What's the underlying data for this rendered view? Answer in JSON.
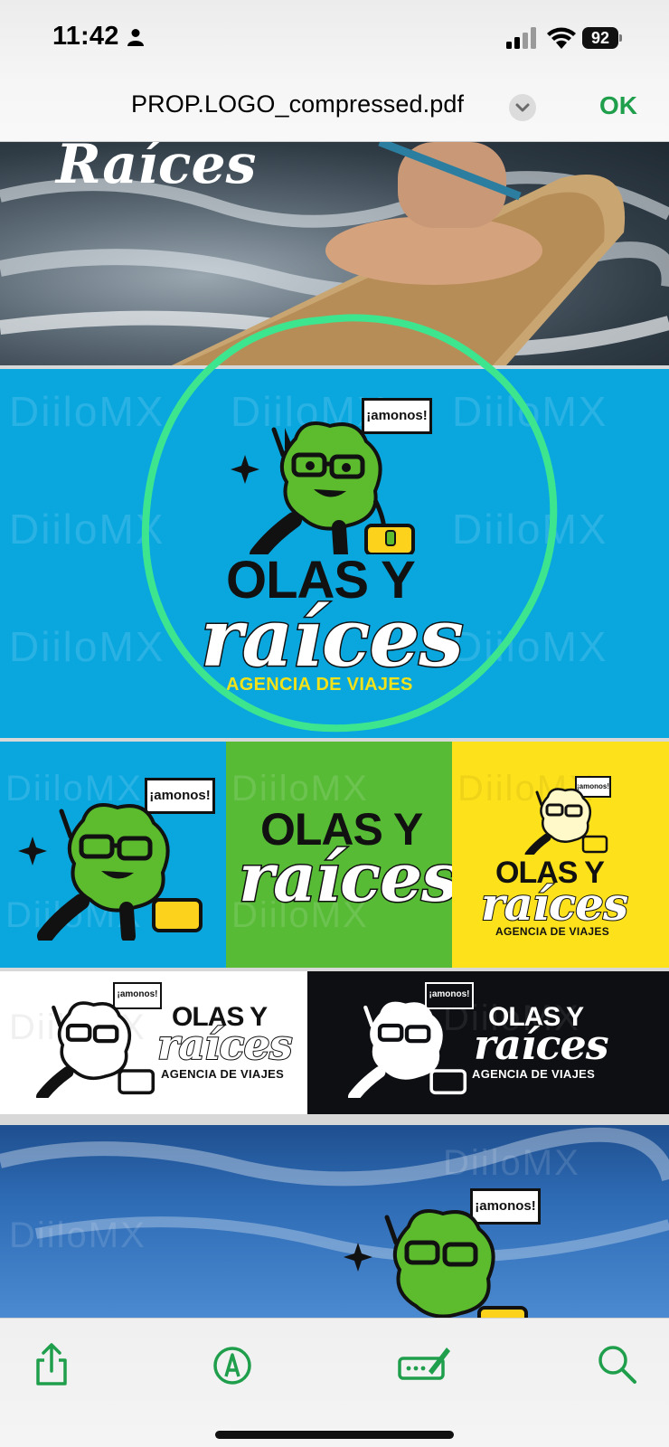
{
  "status_bar": {
    "time": "11:42",
    "battery": "92",
    "icons": [
      "person-icon",
      "signal-icon",
      "wifi-icon",
      "battery-icon"
    ]
  },
  "nav": {
    "title": "PROP.LOGO_compressed.pdf",
    "done": "OK",
    "accent": "#1f9e4b"
  },
  "document": {
    "top_photo_text": "Raíces",
    "watermark": "DiiloMX",
    "brand": {
      "line1": "OLAS Y",
      "line2": "raíces",
      "tagline": "AGENCIA DE VIAJES",
      "speech": "¡amonos!"
    },
    "panel_colors": {
      "blue": "#0aa7df",
      "green": "#57bb36",
      "yellow": "#fde11b",
      "white": "#ffffff",
      "black": "#0d0f12",
      "annotation": "#3ee58f"
    }
  },
  "toolbar": {
    "icons": [
      "share-icon",
      "markup-icon",
      "signature-icon",
      "search-icon"
    ]
  }
}
